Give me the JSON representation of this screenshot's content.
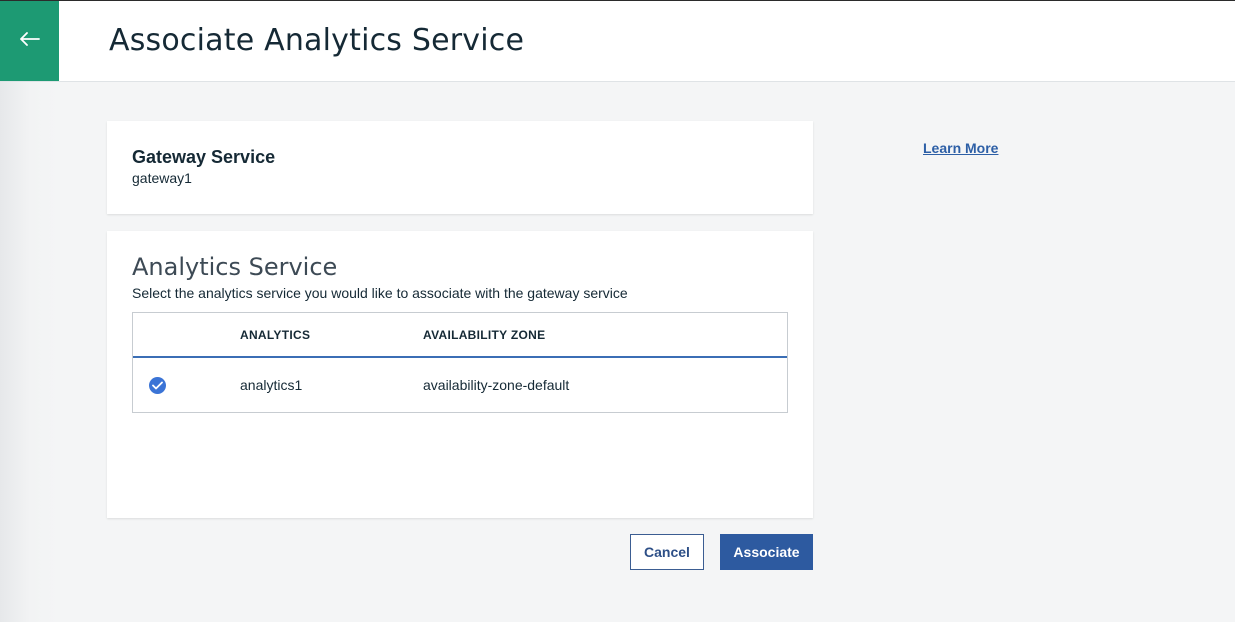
{
  "header": {
    "title": "Associate Analytics Service",
    "back_icon": "arrow-left-icon",
    "accent_color": "#1d9a73"
  },
  "gateway": {
    "heading": "Gateway Service",
    "value": "gateway1"
  },
  "analytics": {
    "heading": "Analytics Service",
    "description": "Select the analytics service you would like to associate with the gateway service",
    "columns": [
      "ANALYTICS",
      "AVAILABILITY ZONE"
    ],
    "rows": [
      {
        "selected": true,
        "analytics": "analytics1",
        "zone": "availability-zone-default"
      }
    ]
  },
  "learn_more": "Learn More",
  "actions": {
    "cancel": "Cancel",
    "associate": "Associate"
  },
  "colors": {
    "primary_button": "#2d5aa0",
    "link": "#2d5fa6",
    "radio_selected": "#3b74d6"
  }
}
